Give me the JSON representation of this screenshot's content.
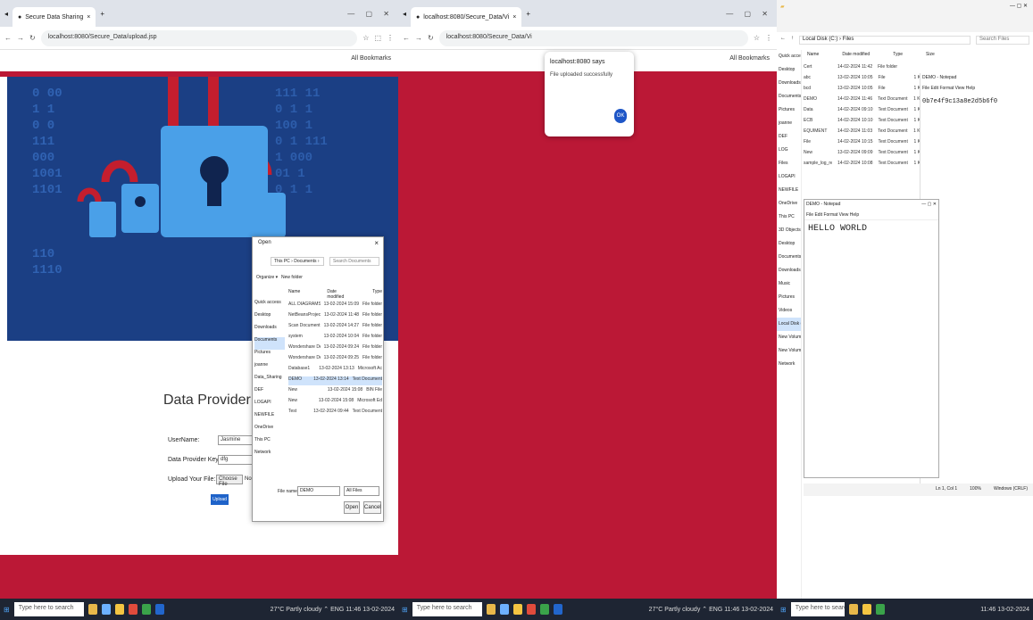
{
  "left_browser": {
    "tab_title": "Secure Data Sharing",
    "url": "localhost:8080/Secure_Data/upload.jsp",
    "bookmarks": "All Bookmarks",
    "form": {
      "title": "Data Provider Upload File",
      "username_label": "UserName:",
      "username_value": "Jasmine",
      "key_label": "Data Provider Key:",
      "key_value": "dfg",
      "file_label": "Upload Your File:",
      "choose_button": "Choose File",
      "no_file": "No file chosen",
      "upload_button": "Upload"
    },
    "open_dialog": {
      "title": "Open",
      "path": "This PC › Documents ›",
      "search_placeholder": "Search Documents",
      "organize": "Organize ▾",
      "new_folder": "New folder",
      "col_name": "Name",
      "col_date": "Date modified",
      "col_type": "Type",
      "nav": [
        "Quick access",
        "Desktop",
        "Downloads",
        "Documents",
        "Pictures",
        "joanne",
        "Data_Sharing",
        "DEF",
        "LOGAPI",
        "NEWFILE",
        "OneDrive",
        "This PC",
        "Network"
      ],
      "files": [
        {
          "name": "ALL DIAGRAMS",
          "date": "13-02-2024 15:09",
          "type": "File folder"
        },
        {
          "name": "NetBeansProjects",
          "date": "13-02-2024 11:48",
          "type": "File folder"
        },
        {
          "name": "Scan Document",
          "date": "13-02-2024 14:27",
          "type": "File folder"
        },
        {
          "name": "system",
          "date": "13-02-2024 10:04",
          "type": "File folder"
        },
        {
          "name": "Wondershare Demo Creator",
          "date": "13-02-2024 09:24",
          "type": "File folder"
        },
        {
          "name": "Wondershare Demo Creator Spark",
          "date": "13-02-2024 09:25",
          "type": "File folder"
        },
        {
          "name": "Database1",
          "date": "13-02-2024 13:13",
          "type": "Microsoft Ac"
        },
        {
          "name": "DEMO",
          "date": "13-02-2024 13:14",
          "type": "Text Document"
        },
        {
          "name": "New",
          "date": "13-02-2024 15:08",
          "type": "BIN File"
        },
        {
          "name": "New",
          "date": "13-02-2024 15:08",
          "type": "Microsoft Ed"
        },
        {
          "name": "Test",
          "date": "13-02-2024 09:44",
          "type": "Text Document"
        }
      ],
      "filename_label": "File name:",
      "filename_value": "DEMO",
      "filter": "All Files",
      "open_button": "Open",
      "cancel_button": "Cancel"
    }
  },
  "middle_browser": {
    "tab_title": "localhost:8080/Secure_Data/Vi",
    "url": "localhost:8080/Secure_Data/Vi",
    "bookmarks": "All Bookmarks",
    "alert": {
      "title": "localhost:8080 says",
      "message": "File uploaded successfully",
      "ok_button": "OK"
    }
  },
  "right_explorer": {
    "title": "Local Disk (C:) › Files",
    "search_placeholder": "Search Files",
    "col_name": "Name",
    "col_date": "Date modified",
    "col_type": "Type",
    "col_size": "Size",
    "nav": [
      "Quick access",
      "Desktop",
      "Downloads",
      "Documents",
      "Pictures",
      "joanne",
      "DEF",
      "LOG",
      "Files",
      "LOGAPI",
      "NEWFILE",
      "OneDrive",
      "This PC",
      "3D Objects",
      "Desktop",
      "Documents",
      "Downloads",
      "Music",
      "Pictures",
      "Videos",
      "Local Disk (C:)",
      "New Volume (D:)",
      "New Volume (E:)",
      "Network"
    ],
    "files": [
      {
        "name": "Cert",
        "date": "14-02-2024 11:42",
        "type": "File folder",
        "size": ""
      },
      {
        "name": "abc",
        "date": "13-02-2024 10:05",
        "type": "File",
        "size": "1 KB"
      },
      {
        "name": "bcd",
        "date": "13-02-2024 10:05",
        "type": "File",
        "size": "1 KB"
      },
      {
        "name": "DEMO",
        "date": "14-02-2024 11:46",
        "type": "Text Document",
        "size": "1 KB"
      },
      {
        "name": "Data",
        "date": "14-02-2024 09:10",
        "type": "Text Document",
        "size": "1 KB"
      },
      {
        "name": "ECB",
        "date": "14-02-2024 10:10",
        "type": "Text Document",
        "size": "1 KB"
      },
      {
        "name": "EQUIMENT",
        "date": "14-02-2024 11:03",
        "type": "Text Document",
        "size": "1 KB"
      },
      {
        "name": "File",
        "date": "14-02-2024 10:15",
        "type": "Text Document",
        "size": "1 KB"
      },
      {
        "name": "New",
        "date": "13-02-2024 09:09",
        "type": "Text Document",
        "size": "1 KB"
      },
      {
        "name": "sample_log_response",
        "date": "14-02-2024 10:08",
        "type": "Text Document",
        "size": "1 KB"
      }
    ],
    "notepad_back_title": "DEMO - Notepad",
    "notepad_back_menu": "File  Edit  Format  View  Help",
    "notepad_back_text": "0b7e4f9c13a8e2d5b6f0",
    "notepad": {
      "title": "DEMO - Notepad",
      "menu": "File  Edit  Format  View  Help",
      "content": "HELLO WORLD",
      "status_pos": "Ln 1, Col 1",
      "status_zoom": "100%",
      "status_eol": "Windows (CRLF)"
    }
  },
  "taskbar": {
    "search_placeholder": "Type here to search",
    "weather": "27°C Partly cloudy",
    "time": "11:46",
    "date": "13-02-2024",
    "lang": "ENG"
  }
}
